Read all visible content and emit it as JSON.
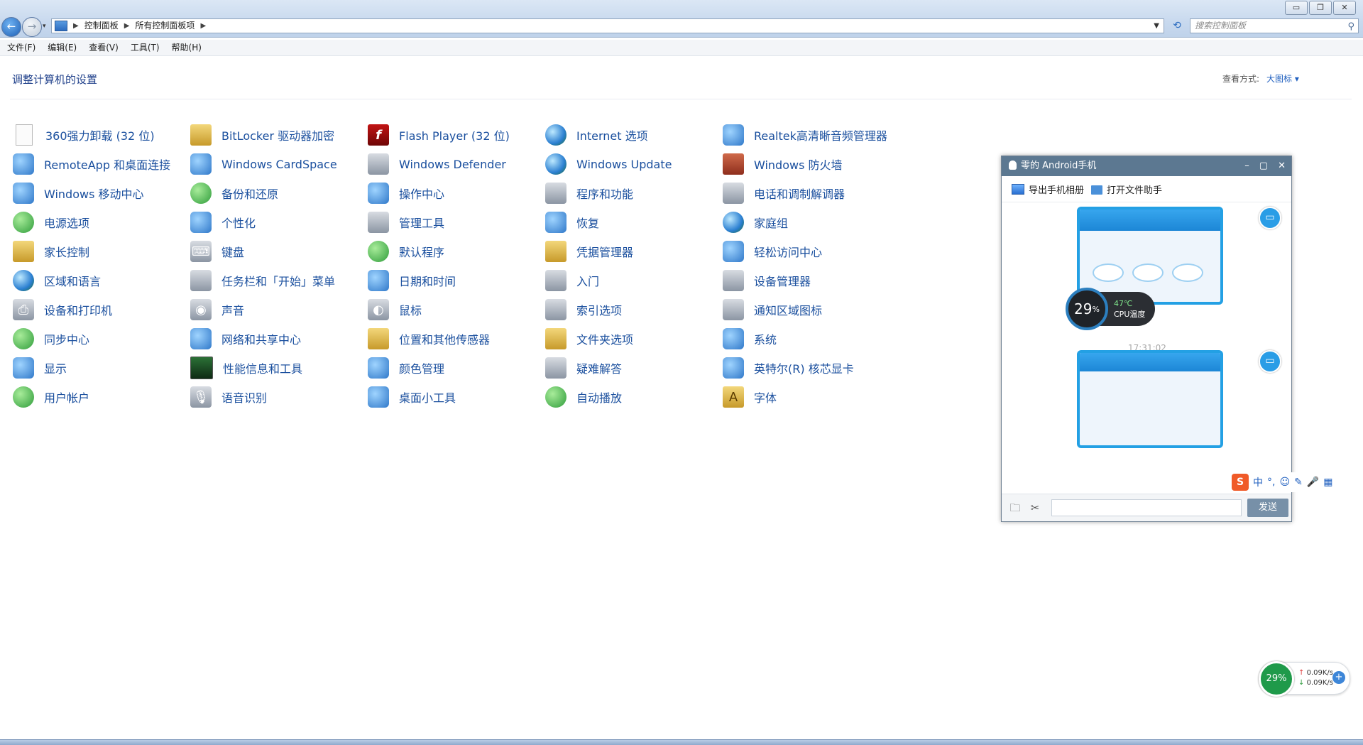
{
  "window": {
    "controls": [
      "▭",
      "❐",
      "✕"
    ]
  },
  "address": {
    "crumbs": [
      "控制面板",
      "所有控制面板项"
    ]
  },
  "search": {
    "placeholder": "搜索控制面板"
  },
  "menu": [
    "文件(F)",
    "编辑(E)",
    "查看(V)",
    "工具(T)",
    "帮助(H)"
  ],
  "header": {
    "title": "调整计算机的设置",
    "view_label": "查看方式:",
    "view_value": "大图标 ▾"
  },
  "items": [
    {
      "label": "360强力卸载 (32 位)",
      "icon": "document-icon"
    },
    {
      "label": "BitLocker 驱动器加密",
      "icon": "bitlocker-key-icon"
    },
    {
      "label": "Flash Player (32 位)",
      "icon": "flash-player-icon"
    },
    {
      "label": "Internet 选项",
      "icon": "internet-options-icon"
    },
    {
      "label": "Realtek高清晰音频管理器",
      "icon": "realtek-audio-icon"
    },
    {
      "label": "RemoteApp 和桌面连接",
      "icon": "remoteapp-icon"
    },
    {
      "label": "Windows CardSpace",
      "icon": "cardspace-icon"
    },
    {
      "label": "Windows Defender",
      "icon": "defender-icon"
    },
    {
      "label": "Windows Update",
      "icon": "windows-update-icon"
    },
    {
      "label": "Windows 防火墙",
      "icon": "firewall-icon"
    },
    {
      "label": "Windows 移动中心",
      "icon": "mobility-center-icon"
    },
    {
      "label": "备份和还原",
      "icon": "backup-icon"
    },
    {
      "label": "操作中心",
      "icon": "action-center-flag-icon"
    },
    {
      "label": "程序和功能",
      "icon": "programs-icon"
    },
    {
      "label": "电话和调制解调器",
      "icon": "phone-modem-icon"
    },
    {
      "label": "电源选项",
      "icon": "power-options-icon"
    },
    {
      "label": "个性化",
      "icon": "personalization-icon"
    },
    {
      "label": "管理工具",
      "icon": "admin-tools-icon"
    },
    {
      "label": "恢复",
      "icon": "recovery-icon"
    },
    {
      "label": "家庭组",
      "icon": "homegroup-icon"
    },
    {
      "label": "家长控制",
      "icon": "parental-controls-icon"
    },
    {
      "label": "键盘",
      "icon": "keyboard-icon"
    },
    {
      "label": "默认程序",
      "icon": "default-programs-icon"
    },
    {
      "label": "凭据管理器",
      "icon": "credential-manager-icon"
    },
    {
      "label": "轻松访问中心",
      "icon": "ease-of-access-icon"
    },
    {
      "label": "区域和语言",
      "icon": "region-language-icon"
    },
    {
      "label": "任务栏和「开始」菜单",
      "icon": "taskbar-start-icon"
    },
    {
      "label": "日期和时间",
      "icon": "date-time-icon"
    },
    {
      "label": "入门",
      "icon": "getting-started-icon"
    },
    {
      "label": "设备管理器",
      "icon": "device-manager-icon"
    },
    {
      "label": "设备和打印机",
      "icon": "printer-icon"
    },
    {
      "label": "声音",
      "icon": "sound-icon"
    },
    {
      "label": "鼠标",
      "icon": "mouse-icon"
    },
    {
      "label": "索引选项",
      "icon": "indexing-icon"
    },
    {
      "label": "通知区域图标",
      "icon": "notification-area-icon"
    },
    {
      "label": "同步中心",
      "icon": "sync-center-icon"
    },
    {
      "label": "网络和共享中心",
      "icon": "network-sharing-icon"
    },
    {
      "label": "位置和其他传感器",
      "icon": "location-sensors-icon"
    },
    {
      "label": "文件夹选项",
      "icon": "folder-options-icon"
    },
    {
      "label": "系统",
      "icon": "system-icon"
    },
    {
      "label": "显示",
      "icon": "display-icon"
    },
    {
      "label": "性能信息和工具",
      "icon": "performance-icon"
    },
    {
      "label": "颜色管理",
      "icon": "color-management-icon"
    },
    {
      "label": "疑难解答",
      "icon": "troubleshooting-icon"
    },
    {
      "label": "英特尔(R) 核芯显卡",
      "icon": "intel-graphics-icon"
    },
    {
      "label": "用户帐户",
      "icon": "user-accounts-icon"
    },
    {
      "label": "语音识别",
      "icon": "speech-recognition-icon"
    },
    {
      "label": "桌面小工具",
      "icon": "gadgets-icon"
    },
    {
      "label": "自动播放",
      "icon": "autoplay-icon"
    },
    {
      "label": "字体",
      "icon": "fonts-icon"
    }
  ],
  "chat": {
    "title": "零的 Android手机",
    "window_controls": [
      "–",
      "▢",
      "✕"
    ],
    "toolbar": [
      "导出手机相册",
      "打开文件助手"
    ],
    "timestamp": "17:31:02",
    "cpu_percent": "29",
    "cpu_percent_suffix": "%",
    "cpu_temp": "47℃",
    "cpu_label": "CPU温度",
    "ime": [
      "中",
      "°,",
      "☺",
      "✎",
      "🎤",
      "▦"
    ],
    "send": "发送"
  },
  "net": {
    "percent": "29%",
    "up": "0.09K/s",
    "down": "0.09K/s"
  },
  "colors": {
    "link": "#1a4f9e",
    "accent": "#23a0e4",
    "chat_title": "#5c7891"
  }
}
